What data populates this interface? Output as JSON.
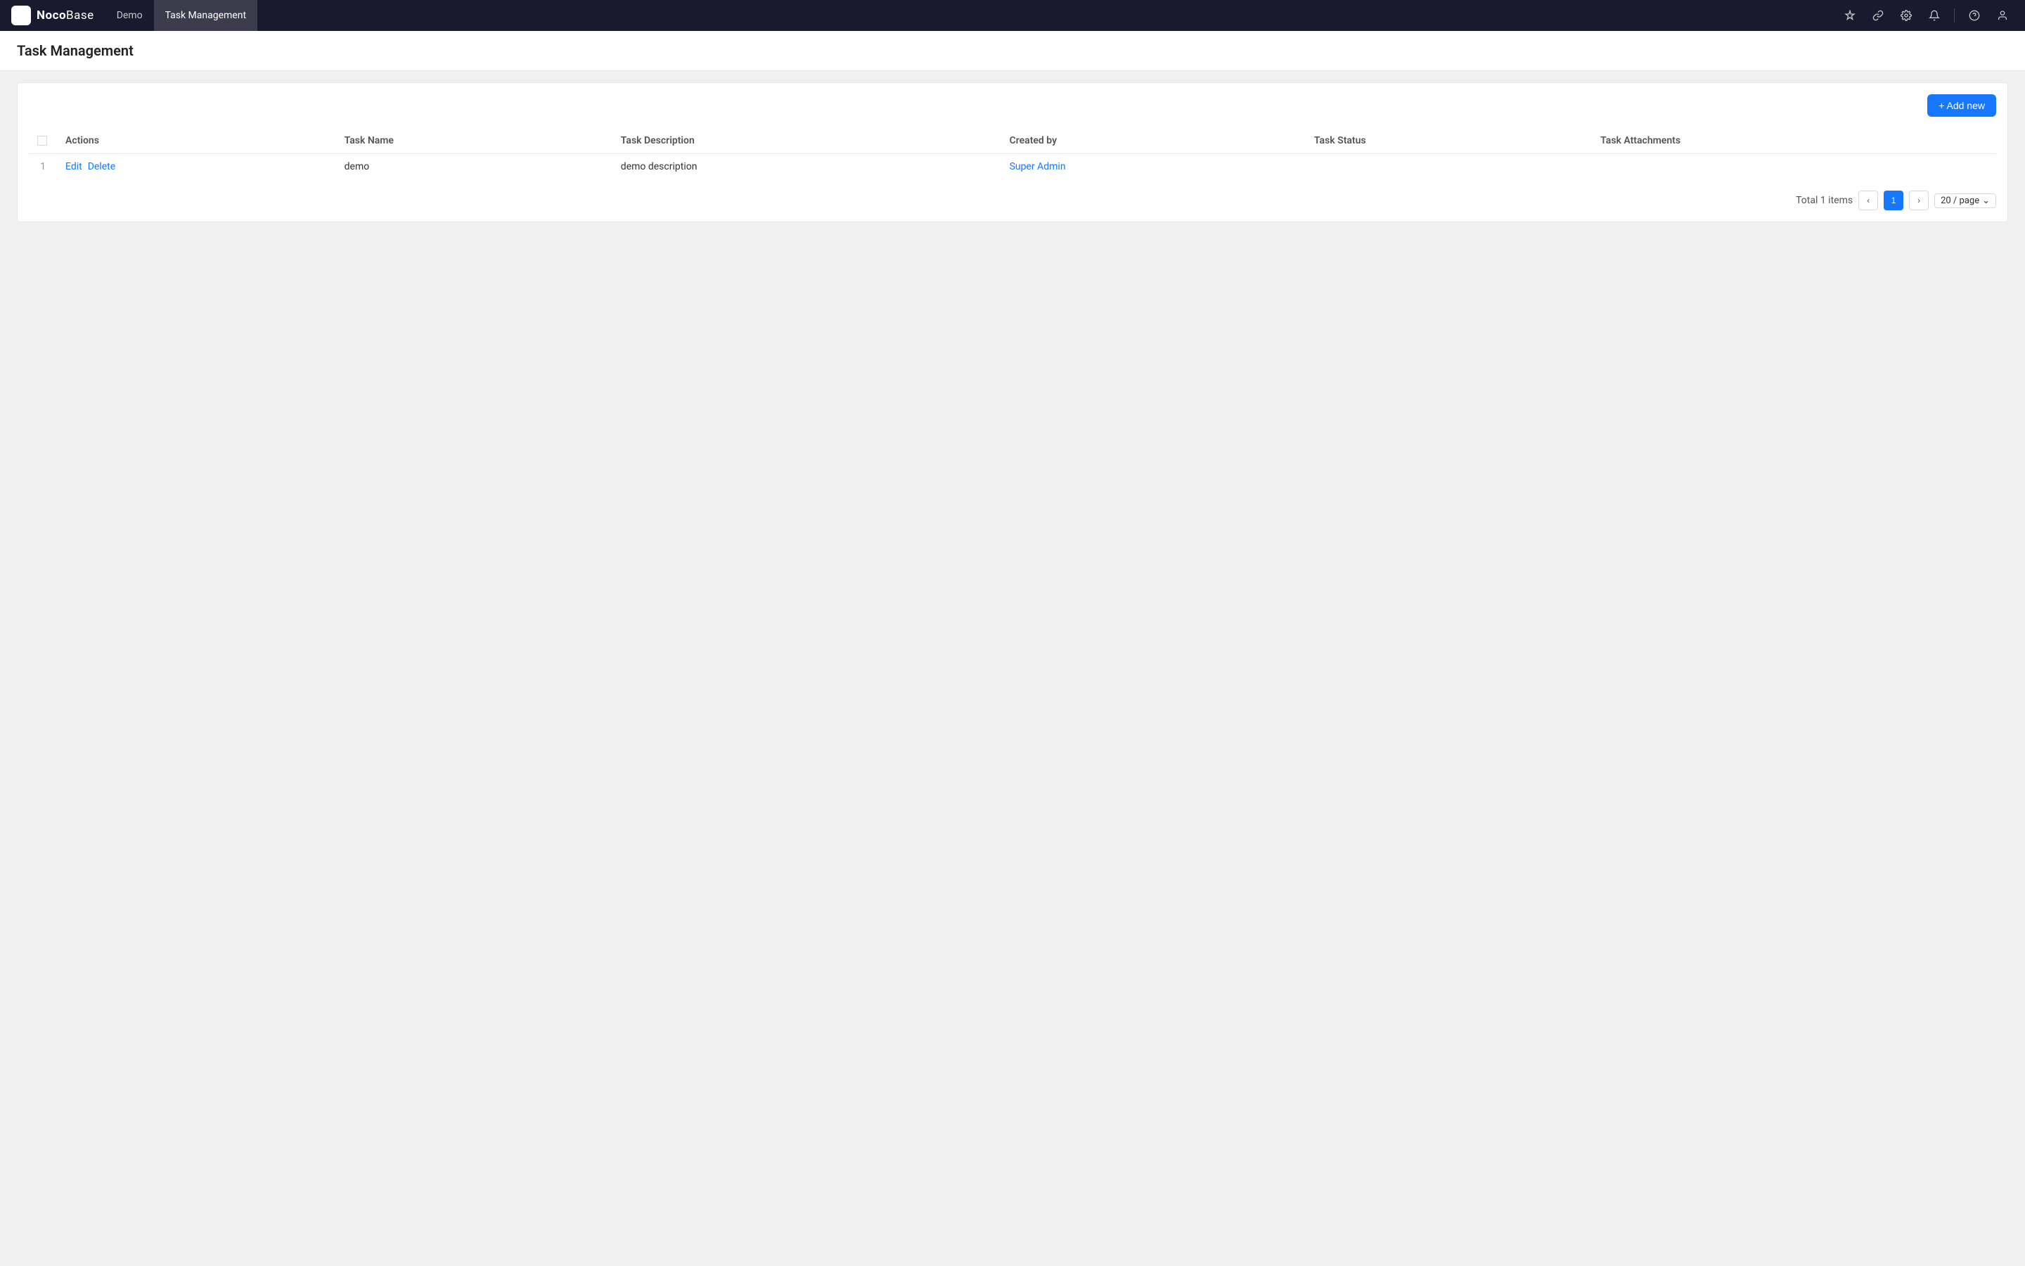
{
  "app": {
    "logo_text_bold": "Noco",
    "logo_text_light": "Base",
    "logo_icon": "🏠"
  },
  "topnav": {
    "items": [
      {
        "label": "Demo",
        "active": false
      },
      {
        "label": "Task Management",
        "active": true
      }
    ],
    "icons": [
      {
        "name": "pin-icon",
        "symbol": "📌"
      },
      {
        "name": "bookmark-icon",
        "symbol": "🔗"
      },
      {
        "name": "settings-icon",
        "symbol": "⚙"
      },
      {
        "name": "bell-icon",
        "symbol": "🔔"
      },
      {
        "name": "help-icon",
        "symbol": "?"
      },
      {
        "name": "user-icon",
        "symbol": "👤"
      }
    ]
  },
  "page": {
    "title": "Task Management"
  },
  "toolbar": {
    "add_new_label": "+ Add new"
  },
  "table": {
    "columns": [
      {
        "key": "actions",
        "label": "Actions"
      },
      {
        "key": "task_name",
        "label": "Task Name"
      },
      {
        "key": "task_description",
        "label": "Task Description"
      },
      {
        "key": "created_by",
        "label": "Created by"
      },
      {
        "key": "task_status",
        "label": "Task Status"
      },
      {
        "key": "task_attachments",
        "label": "Task Attachments"
      }
    ],
    "rows": [
      {
        "num": 1,
        "task_name": "demo",
        "task_description": "demo description",
        "created_by": "Super Admin",
        "task_status": "",
        "task_attachments": ""
      }
    ]
  },
  "pagination": {
    "total_label": "Total 1 items",
    "current_page": 1,
    "page_size": "20 / page"
  }
}
